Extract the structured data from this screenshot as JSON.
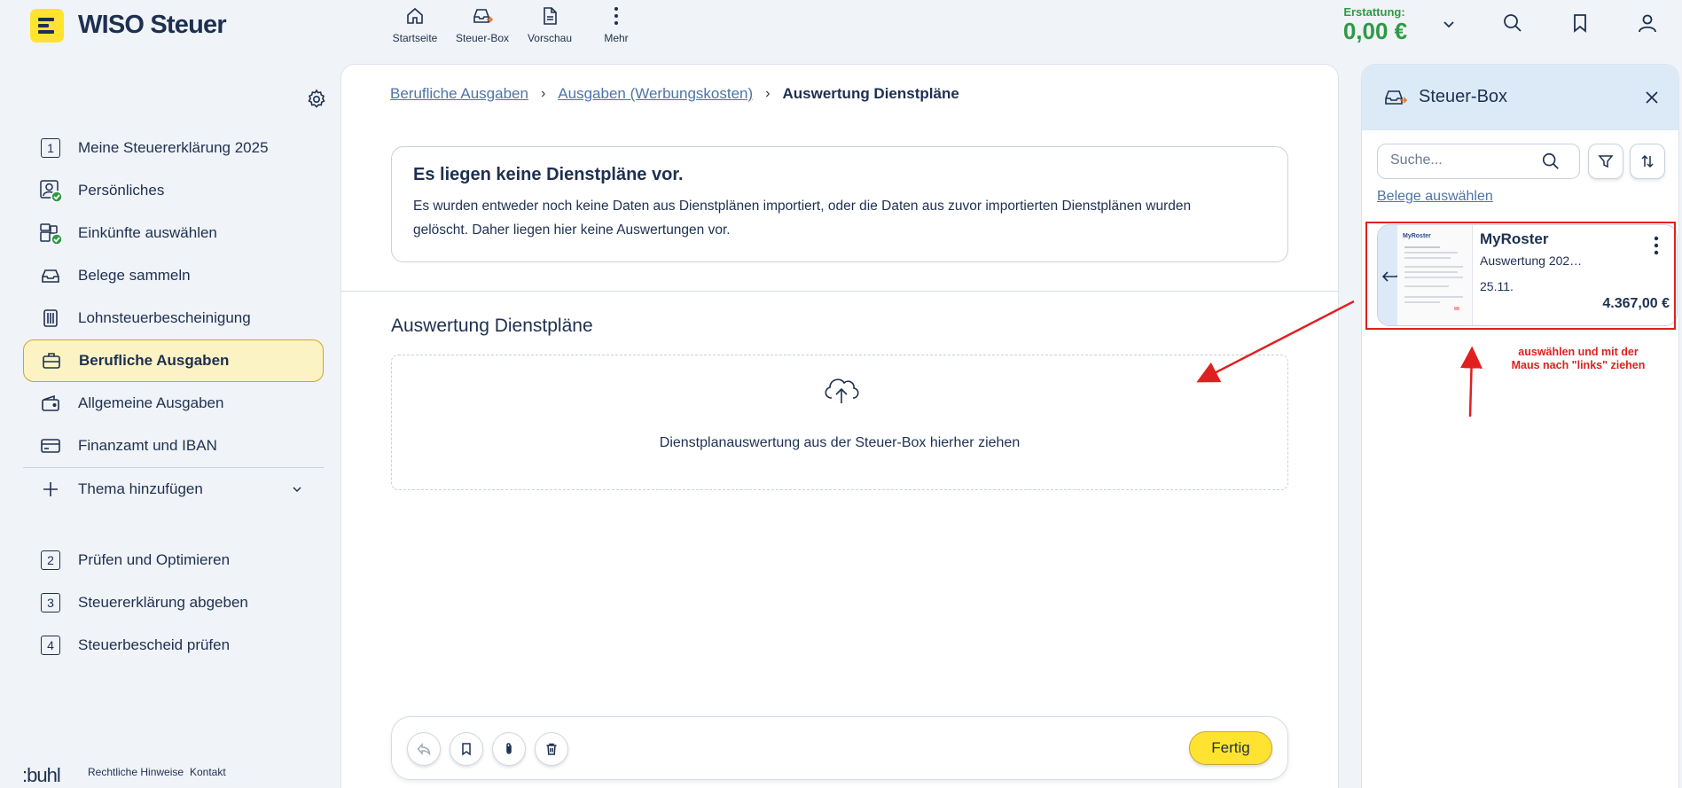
{
  "app": {
    "name": "WISO Steuer"
  },
  "nav": {
    "items": [
      {
        "label": "Startseite",
        "icon": "home-icon"
      },
      {
        "label": "Steuer-Box",
        "icon": "inbox-icon"
      },
      {
        "label": "Vorschau",
        "icon": "document-icon"
      },
      {
        "label": "Mehr",
        "icon": "more-vertical-icon"
      }
    ]
  },
  "refund": {
    "label": "Erstattung:",
    "value": "0,00 €",
    "color": "#2e9a43"
  },
  "sidebar": {
    "items": [
      {
        "label": "Meine Steuererklärung 2025",
        "number": "1"
      },
      {
        "label": "Persönliches",
        "icon": "person-check-icon"
      },
      {
        "label": "Einkünfte auswählen",
        "icon": "income-check-icon"
      },
      {
        "label": "Belege sammeln",
        "icon": "inbox-icon"
      },
      {
        "label": "Lohnsteuerbescheinigung",
        "icon": "certificate-icon"
      },
      {
        "label": "Berufliche Ausgaben",
        "icon": "briefcase-icon",
        "active": true
      },
      {
        "label": "Allgemeine Ausgaben",
        "icon": "wallet-icon"
      },
      {
        "label": "Finanzamt und IBAN",
        "icon": "card-icon"
      },
      {
        "label": "Thema hinzufügen",
        "icon": "plus-icon"
      },
      {
        "label": "Prüfen und Optimieren",
        "number": "2"
      },
      {
        "label": "Steuererklärung abgeben",
        "number": "3"
      },
      {
        "label": "Steuerbescheid prüfen",
        "number": "4"
      }
    ]
  },
  "footer": {
    "brand": ":buhl",
    "legal": "Rechtliche Hinweise",
    "contact": "Kontakt"
  },
  "breadcrumb": {
    "items": [
      "Berufliche Ausgaben",
      "Ausgaben (Werbungskosten)"
    ],
    "current": "Auswertung Dienstpläne"
  },
  "info": {
    "title": "Es liegen keine Dienstpläne vor.",
    "line1": "Es wurden entweder noch keine Daten aus Dienstplänen importiert, oder die Daten aus zuvor importierten Dienstplänen wurden",
    "line2": "gelöscht. Daher liegen hier keine Auswertungen vor."
  },
  "section": {
    "title": "Auswertung Dienstpläne"
  },
  "dropzone": {
    "text": "Dienstplanauswertung aus der Steuer-Box hierher ziehen"
  },
  "toolbar": {
    "done_label": "Fertig",
    "accent": "#ffe330"
  },
  "steuerbox": {
    "title": "Steuer-Box",
    "search_placeholder": "Suche...",
    "select_link": "Belege auswählen",
    "card": {
      "name": "MyRoster",
      "subtitle": "Auswertung 202…",
      "date": "25.11.",
      "amount": "4.367,00 €",
      "thumb_logo": "MyRoster"
    }
  },
  "annotation": {
    "line1": "auswählen und mit der",
    "line2": "Maus nach \"links\" ziehen",
    "color": "#e02020"
  }
}
